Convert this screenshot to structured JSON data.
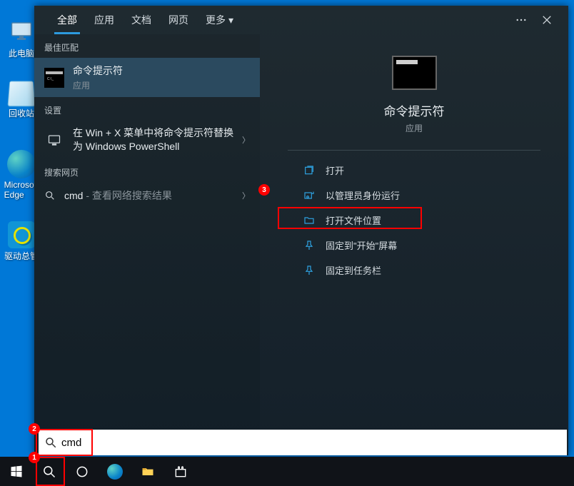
{
  "desktop": {
    "thispc": "此电脑",
    "recycle": "回收站",
    "edge": "Microsoft Edge",
    "drv": "驱动总管"
  },
  "tabs": {
    "all": "全部",
    "apps": "应用",
    "docs": "文档",
    "web": "网页",
    "more": "更多"
  },
  "sections": {
    "best_match": "最佳匹配",
    "settings": "设置",
    "web_search": "搜索网页"
  },
  "best_result": {
    "title": "命令提示符",
    "sub": "应用"
  },
  "setting_result": {
    "title": "在 Win + X 菜单中将命令提示符替换为 Windows PowerShell"
  },
  "web_result": {
    "query": "cmd",
    "suffix": " - 查看网络搜索结果"
  },
  "preview": {
    "title": "命令提示符",
    "sub": "应用"
  },
  "actions": {
    "open": "打开",
    "run_admin": "以管理员身份运行",
    "open_location": "打开文件位置",
    "pin_start": "固定到\"开始\"屏幕",
    "pin_taskbar": "固定到任务栏"
  },
  "search": {
    "value": "cmd",
    "placeholder": ""
  },
  "badges": {
    "one": "1",
    "two": "2",
    "three": "3"
  }
}
